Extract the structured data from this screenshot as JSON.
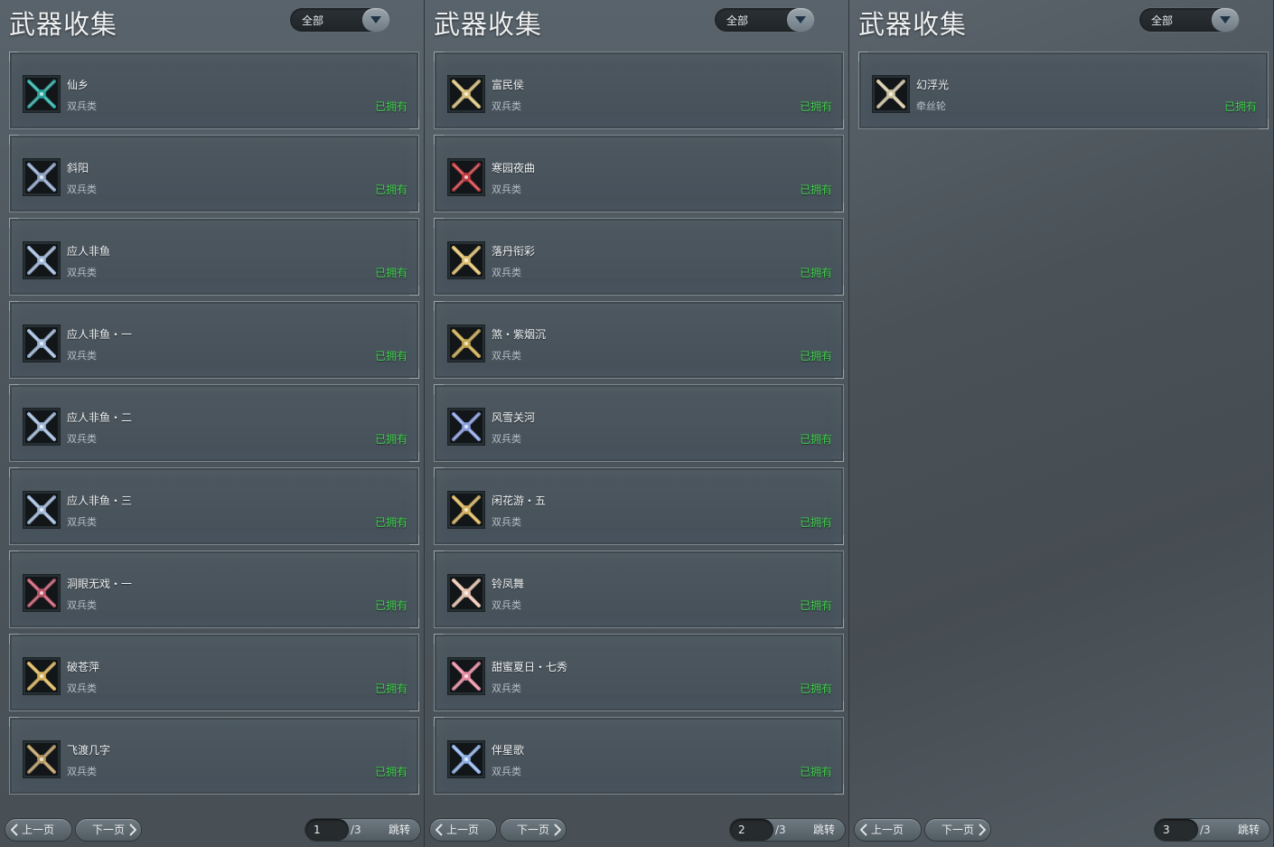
{
  "panels": [
    {
      "title": "武器收集",
      "filter": "全部",
      "items": [
        {
          "name": "仙乡",
          "type": "双兵类",
          "status": "已拥有",
          "icon": "weapon-icon-xianxiang",
          "color": "#2aa7a0"
        },
        {
          "name": "斜阳",
          "type": "双兵类",
          "status": "已拥有",
          "icon": "weapon-icon-xieyang",
          "color": "#8fa4c8"
        },
        {
          "name": "应人非鱼",
          "type": "双兵类",
          "status": "已拥有",
          "icon": "weapon-icon-yingrenfeiyu",
          "color": "#9fb8d8"
        },
        {
          "name": "应人非鱼・一",
          "type": "双兵类",
          "status": "已拥有",
          "icon": "weapon-icon-yingrenfeiyu-1",
          "color": "#9fb8d8"
        },
        {
          "name": "应人非鱼・二",
          "type": "双兵类",
          "status": "已拥有",
          "icon": "weapon-icon-yingrenfeiyu-2",
          "color": "#9fb8d8"
        },
        {
          "name": "应人非鱼・三",
          "type": "双兵类",
          "status": "已拥有",
          "icon": "weapon-icon-yingrenfeiyu-3",
          "color": "#9fb8d8"
        },
        {
          "name": "洞眼无戏・一",
          "type": "双兵类",
          "status": "已拥有",
          "icon": "weapon-icon-dongyanwuxi",
          "color": "#c0566b"
        },
        {
          "name": "破苍萍",
          "type": "双兵类",
          "status": "已拥有",
          "icon": "weapon-icon-pocangping",
          "color": "#d8b25a"
        },
        {
          "name": "飞渡几字",
          "type": "双兵类",
          "status": "已拥有",
          "icon": "weapon-icon-feiduji",
          "color": "#b89a62"
        }
      ],
      "pager": {
        "prev": "上一页",
        "next": "下一页",
        "page": "1",
        "total": "/3",
        "jump": "跳转"
      }
    },
    {
      "title": "武器收集",
      "filter": "全部",
      "items": [
        {
          "name": "富民侯",
          "type": "双兵类",
          "status": "已拥有",
          "icon": "weapon-icon-fuminhou",
          "color": "#d8c07a"
        },
        {
          "name": "寒园夜曲",
          "type": "双兵类",
          "status": "已拥有",
          "icon": "weapon-icon-hanyuanyequ",
          "color": "#c23a3f"
        },
        {
          "name": "落丹衔彩",
          "type": "双兵类",
          "status": "已拥有",
          "icon": "weapon-icon-luodanxiancai",
          "color": "#e0c070"
        },
        {
          "name": "煞・紫烟沉",
          "type": "双兵类",
          "status": "已拥有",
          "icon": "weapon-icon-sha-ziyanchen",
          "color": "#c8a84e"
        },
        {
          "name": "风雪关河",
          "type": "双兵类",
          "status": "已拥有",
          "icon": "weapon-icon-fengxueguanhe",
          "color": "#8a9fe0"
        },
        {
          "name": "闲花游・五",
          "type": "双兵类",
          "status": "已拥有",
          "icon": "weapon-icon-xianhuayou",
          "color": "#d6b25c"
        },
        {
          "name": "铃凤舞",
          "type": "双兵类",
          "status": "已拥有",
          "icon": "weapon-icon-lingfengwu",
          "color": "#e8c4b0"
        },
        {
          "name": "甜蜜夏日・七秀",
          "type": "双兵类",
          "status": "已拥有",
          "icon": "weapon-icon-tianmixiari",
          "color": "#e58aa0"
        },
        {
          "name": "伴星歌",
          "type": "双兵类",
          "status": "已拥有",
          "icon": "weapon-icon-banxingge",
          "color": "#8fb2e8"
        }
      ],
      "pager": {
        "prev": "上一页",
        "next": "下一页",
        "page": "2",
        "total": "/3",
        "jump": "跳转"
      }
    },
    {
      "title": "武器收集",
      "filter": "全部",
      "items": [
        {
          "name": "幻浮光",
          "type": "牵丝轮",
          "status": "已拥有",
          "icon": "weapon-icon-huanfuguang",
          "color": "#d2c6a4"
        }
      ],
      "pager": {
        "prev": "上一页",
        "next": "下一页",
        "page": "3",
        "total": "/3",
        "jump": "跳转"
      }
    }
  ]
}
